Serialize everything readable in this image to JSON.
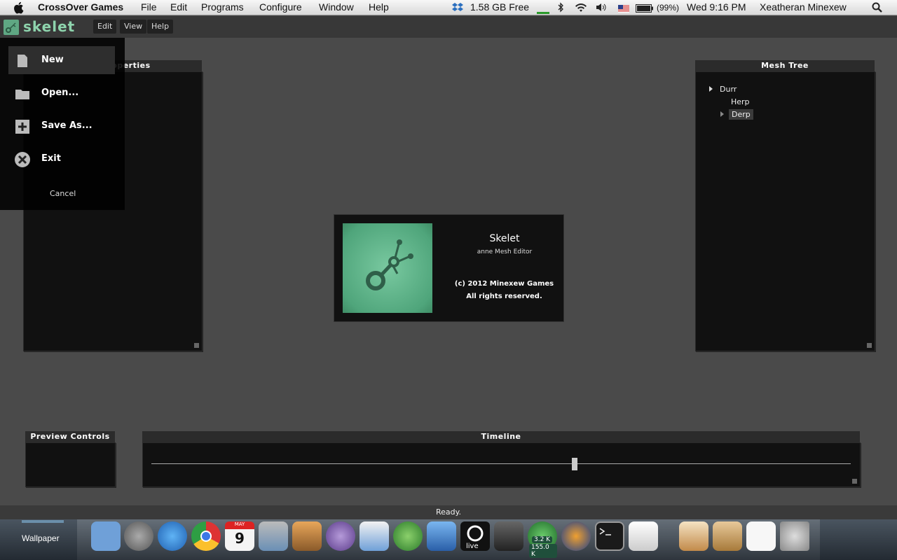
{
  "mac_menubar": {
    "app_name": "CrossOver Games",
    "menus": [
      "File",
      "Edit",
      "Programs",
      "Configure",
      "Window",
      "Help"
    ],
    "disk_free": "1.58 GB Free",
    "battery": "(99%)",
    "clock": "Wed 9:16 PM",
    "user": "Xeatheran Minexew"
  },
  "app": {
    "title": "skelet",
    "menus": [
      "Edit",
      "View",
      "Help"
    ]
  },
  "file_menu": {
    "items": [
      {
        "label": "New",
        "icon": "new-file-icon"
      },
      {
        "label": "Open...",
        "icon": "folder-icon"
      },
      {
        "label": "Save As...",
        "icon": "plus-icon"
      },
      {
        "label": "Exit",
        "icon": "close-icon"
      }
    ],
    "cancel": "Cancel"
  },
  "panels": {
    "node_properties": "Node Properties",
    "mesh_tree": "Mesh Tree",
    "preview_controls": "Preview Controls",
    "timeline": "Timeline"
  },
  "mesh_tree": {
    "nodes": [
      "Durr",
      "Herp",
      "Derp"
    ]
  },
  "about": {
    "title": "Skelet",
    "subtitle": "anne Mesh Editor",
    "copyright": "(c) 2012 Minexew Games",
    "rights": "All rights reserved."
  },
  "timeline": {
    "position": 0.605
  },
  "status": "Ready.",
  "dock": {
    "wallpaper_label": "Wallpaper",
    "utorrent_up": "3.2 K",
    "utorrent_down": "155.0 K",
    "calendar_day": "9",
    "calendar_month": "MAY"
  },
  "colors": {
    "accent": "#8ed4ad",
    "panel_bg": "#111111",
    "workspace_bg": "#4a4a4a"
  }
}
